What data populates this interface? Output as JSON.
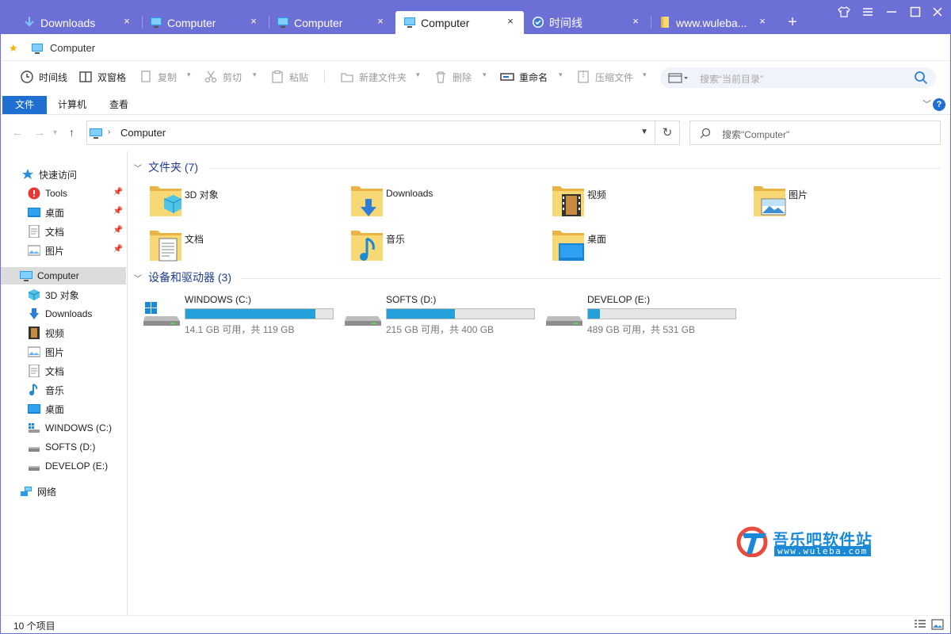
{
  "tabs": [
    {
      "label": "Downloads",
      "icon": "download-arrow-icon"
    },
    {
      "label": "Computer",
      "icon": "computer-icon"
    },
    {
      "label": "Computer",
      "icon": "computer-icon"
    },
    {
      "label": "Computer",
      "icon": "computer-icon",
      "active": true
    },
    {
      "label": "时间线",
      "icon": "timeline-icon"
    },
    {
      "label": "www.wuleba...",
      "icon": "folder-icon"
    }
  ],
  "tab_close_glyph": "×",
  "add_tab_glyph": "+",
  "favbar": {
    "label": "Computer"
  },
  "toolbar": {
    "timeline": "时间线",
    "dual_pane": "双窗格",
    "copy": "复制",
    "cut": "剪切",
    "paste": "粘贴",
    "new_folder": "新建文件夹",
    "delete": "删除",
    "rename": "重命名",
    "compress": "压缩文件",
    "search_placeholder": "搜索“当前目录”"
  },
  "ribbon": {
    "file": "文件",
    "computer": "计算机",
    "view": "查看"
  },
  "address": {
    "path": "Computer",
    "search_placeholder": "搜索\"Computer\""
  },
  "sidebar": {
    "quick_access": "快速访问",
    "quick_items": [
      "Tools",
      "桌面",
      "文档",
      "图片"
    ],
    "computer": "Computer",
    "computer_items": [
      "3D 对象",
      "Downloads",
      "视频",
      "图片",
      "文档",
      "音乐",
      "桌面",
      "WINDOWS (C:)",
      "SOFTS (D:)",
      "DEVELOP (E:)"
    ],
    "network": "网络"
  },
  "groups": {
    "folders_title": "文件夹 (7)",
    "drives_title": "设备和驱动器 (3)"
  },
  "folders": [
    "3D 对象",
    "Downloads",
    "视频",
    "图片",
    "文档",
    "音乐",
    "桌面"
  ],
  "drives": [
    {
      "name": "WINDOWS (C:)",
      "info": "14.1 GB 可用，共 119 GB",
      "used_fraction": 0.88
    },
    {
      "name": "SOFTS (D:)",
      "info": "215 GB 可用，共 400 GB",
      "used_fraction": 0.46
    },
    {
      "name": "DEVELOP (E:)",
      "info": "489 GB 可用，共 531 GB",
      "used_fraction": 0.08
    }
  ],
  "watermark": {
    "title": "吾乐吧软件站",
    "url": "www.wuleba.com"
  },
  "status": {
    "count": "10 个项目"
  },
  "colors": {
    "titlebar": "#6b6fd6",
    "accent": "#1e6fd0",
    "drive_bar": "#26a0da",
    "group_title": "#1e3d8f"
  }
}
